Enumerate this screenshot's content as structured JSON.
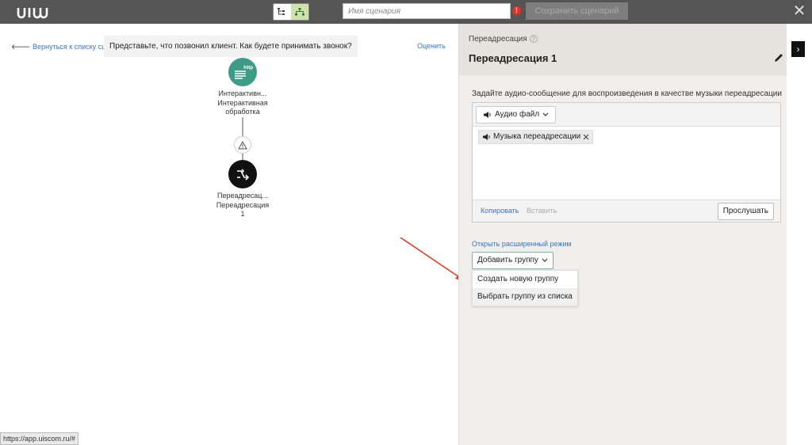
{
  "header": {
    "scenario_placeholder": "Имя сценария",
    "warning_glyph": "!",
    "save_label": "Сохранить сценарий",
    "close_glyph": "✕"
  },
  "canvas": {
    "back_link": "Вернуться к списку сценариев",
    "hint": "Представьте, что позвонил клиент. Как будете принимать звонок?",
    "rate_link": "Оценить",
    "nodes": [
      {
        "badge": "http",
        "title": "Интерактивн...",
        "subtitle_1": "Интерактивная",
        "subtitle_2": "обработка"
      },
      {
        "title": "Переадресац...",
        "subtitle_1": "Переадресация",
        "subtitle_2": "1"
      }
    ],
    "status_url": "https://app.uiscom.ru/#"
  },
  "panel": {
    "subtitle": "Переадресация",
    "help_glyph": "?",
    "title": "Переадресация 1",
    "audio_label": "Задайте аудио-сообщение для воспроизведения в качестве музыки переадресации",
    "audio_dropdown": "Аудио файл",
    "audio_tag": "Музыка переадресации",
    "copy_link": "Копировать",
    "paste_link": "Вставить",
    "listen_button": "Прослушать",
    "advanced_link": "Открыть расширенный режим",
    "add_group_button": "Добавить группу",
    "group_menu": [
      "Создать новую группу",
      "Выбрать группу из списка"
    ]
  },
  "colors": {
    "topbar": "#555555",
    "http_node": "#3e9b88",
    "redirect_node": "#111111",
    "link": "#3b74b8",
    "arrow": "#e0412b"
  }
}
